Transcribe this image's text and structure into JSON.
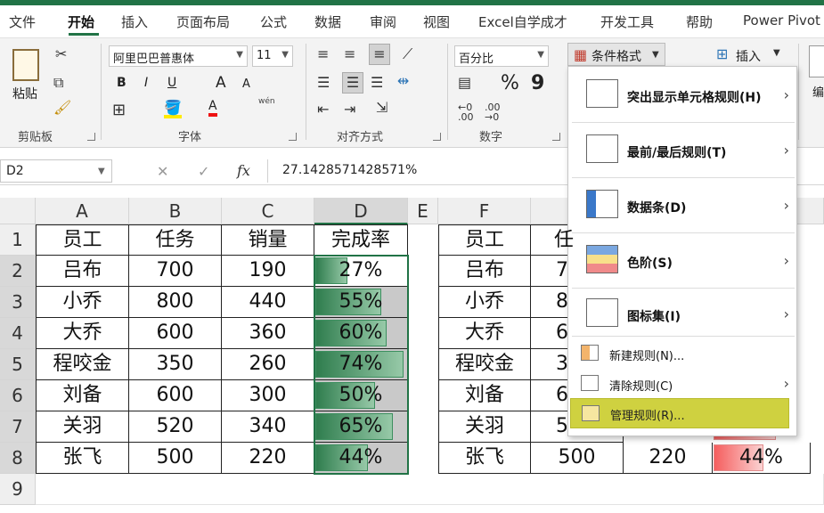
{
  "tabs": [
    "文件",
    "开始",
    "插入",
    "页面布局",
    "公式",
    "数据",
    "审阅",
    "视图",
    "Excel自学成才",
    "开发工具",
    "帮助",
    "Power Pivot"
  ],
  "active_tab": "开始",
  "ribbon": {
    "clipboard": {
      "paste": "粘贴",
      "group": "剪贴板"
    },
    "font": {
      "name": "阿里巴巴普惠体",
      "size": "11",
      "group": "字体",
      "bold": "B",
      "italic": "I",
      "underline": "U",
      "grow": "A",
      "shrink": "A",
      "phonetic": "wén"
    },
    "alignment": {
      "group": "对齐方式"
    },
    "number": {
      "format": "百分比",
      "group": "数字",
      "percent": "%",
      "comma": "9"
    },
    "styles": {
      "conditional": "条件格式"
    },
    "cells": {
      "insert": "插入",
      "edit": "编"
    }
  },
  "formula_bar": {
    "name_box": "D2",
    "formula": "27.1428571428571%"
  },
  "columns": [
    "A",
    "B",
    "C",
    "D",
    "E",
    "F"
  ],
  "rows": [
    "1",
    "2",
    "3",
    "4",
    "5",
    "6",
    "7",
    "8",
    "9"
  ],
  "table_left": {
    "headers": [
      "员工",
      "任务",
      "销量",
      "完成率"
    ],
    "rows": [
      [
        "吕布",
        "700",
        "190",
        "27%"
      ],
      [
        "小乔",
        "800",
        "440",
        "55%"
      ],
      [
        "大乔",
        "600",
        "360",
        "60%"
      ],
      [
        "程咬金",
        "350",
        "260",
        "74%"
      ],
      [
        "刘备",
        "600",
        "300",
        "50%"
      ],
      [
        "关羽",
        "520",
        "340",
        "65%"
      ],
      [
        "张飞",
        "500",
        "220",
        "44%"
      ]
    ],
    "fill": [
      0.27,
      0.55,
      0.6,
      0.74,
      0.5,
      0.65,
      0.44
    ]
  },
  "table_right": {
    "header_visible": [
      "员工",
      "任"
    ],
    "names": [
      "吕布",
      "小乔",
      "大乔",
      "程咬金",
      "刘备",
      "关羽",
      "张飞"
    ],
    "task_partial": [
      "7",
      "8",
      "6",
      "3",
      "6",
      "5"
    ],
    "last_row": {
      "task": "500",
      "sales": "220",
      "rate": "44%"
    },
    "last_fill": 0.44
  },
  "cond_menu": {
    "items": [
      "突出显示单元格规则(H)",
      "最前/最后规则(T)",
      "数据条(D)",
      "色阶(S)",
      "图标集(I)"
    ],
    "small_items": [
      "新建规则(N)...",
      "清除规则(C)",
      "管理规则(R)..."
    ]
  }
}
